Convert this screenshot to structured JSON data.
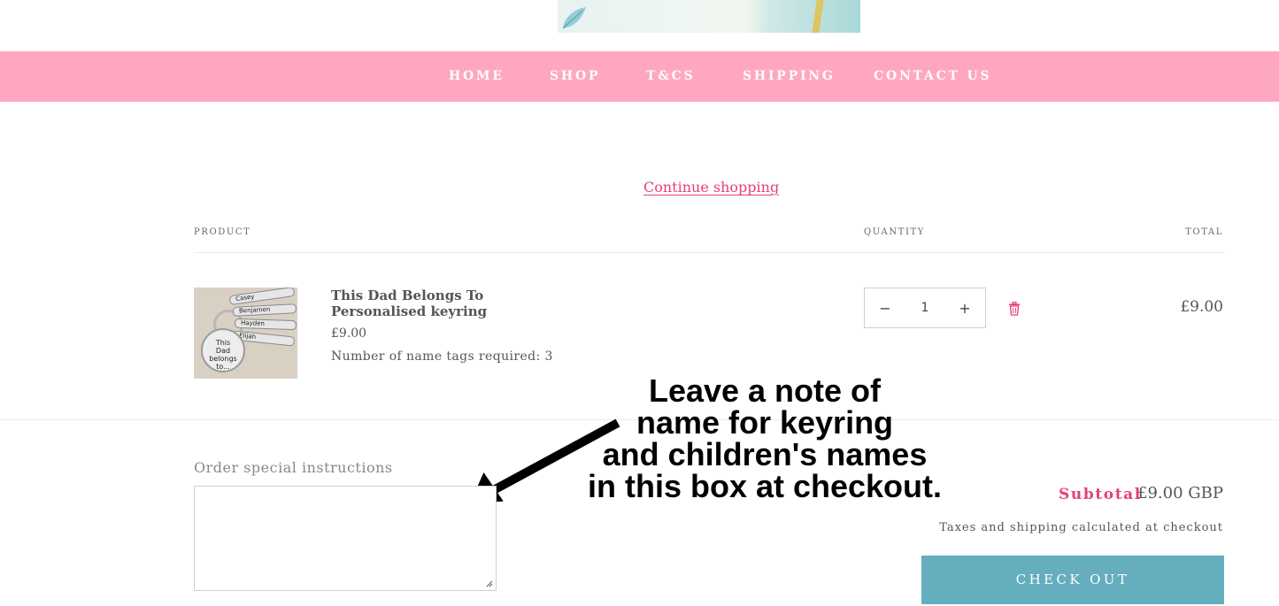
{
  "nav": {
    "items": [
      {
        "label": "HOME"
      },
      {
        "label": "SHOP"
      },
      {
        "label": "T&CS"
      },
      {
        "label": "SHIPPING"
      },
      {
        "label": "CONTACT US"
      }
    ]
  },
  "cart": {
    "continue_label": "Continue shopping",
    "columns": {
      "product": "PRODUCT",
      "quantity": "QUANTITY",
      "total": "TOTAL"
    },
    "item": {
      "title": "This Dad Belongs To Personalised keyring",
      "price": "£9.00",
      "option": "Number of name tags required: 3",
      "quantity": "1",
      "line_total": "£9.00",
      "image_text": {
        "tags": [
          "Casey",
          "Benjamen",
          "Hayden",
          "Elijah"
        ],
        "disc_lines": [
          "This",
          "Dad",
          "belongs",
          "to..."
        ]
      }
    },
    "notes_label": "Order special instructions",
    "notes_value": "",
    "subtotal_label": "Subtotal",
    "subtotal_value": "£9.00 GBP",
    "tax_note": "Taxes and shipping calculated at checkout",
    "checkout_label": "CHECK OUT"
  },
  "annotation": {
    "lines": [
      "Leave a note of",
      "name for keyring",
      "and children's names",
      "in this box at checkout."
    ]
  },
  "colors": {
    "nav_bg": "#ffa7c1",
    "accent": "#e5407a",
    "checkout_bg": "#64aebd"
  },
  "icons": [
    "minus-icon",
    "plus-icon",
    "trash-icon",
    "arrow-annotation"
  ]
}
